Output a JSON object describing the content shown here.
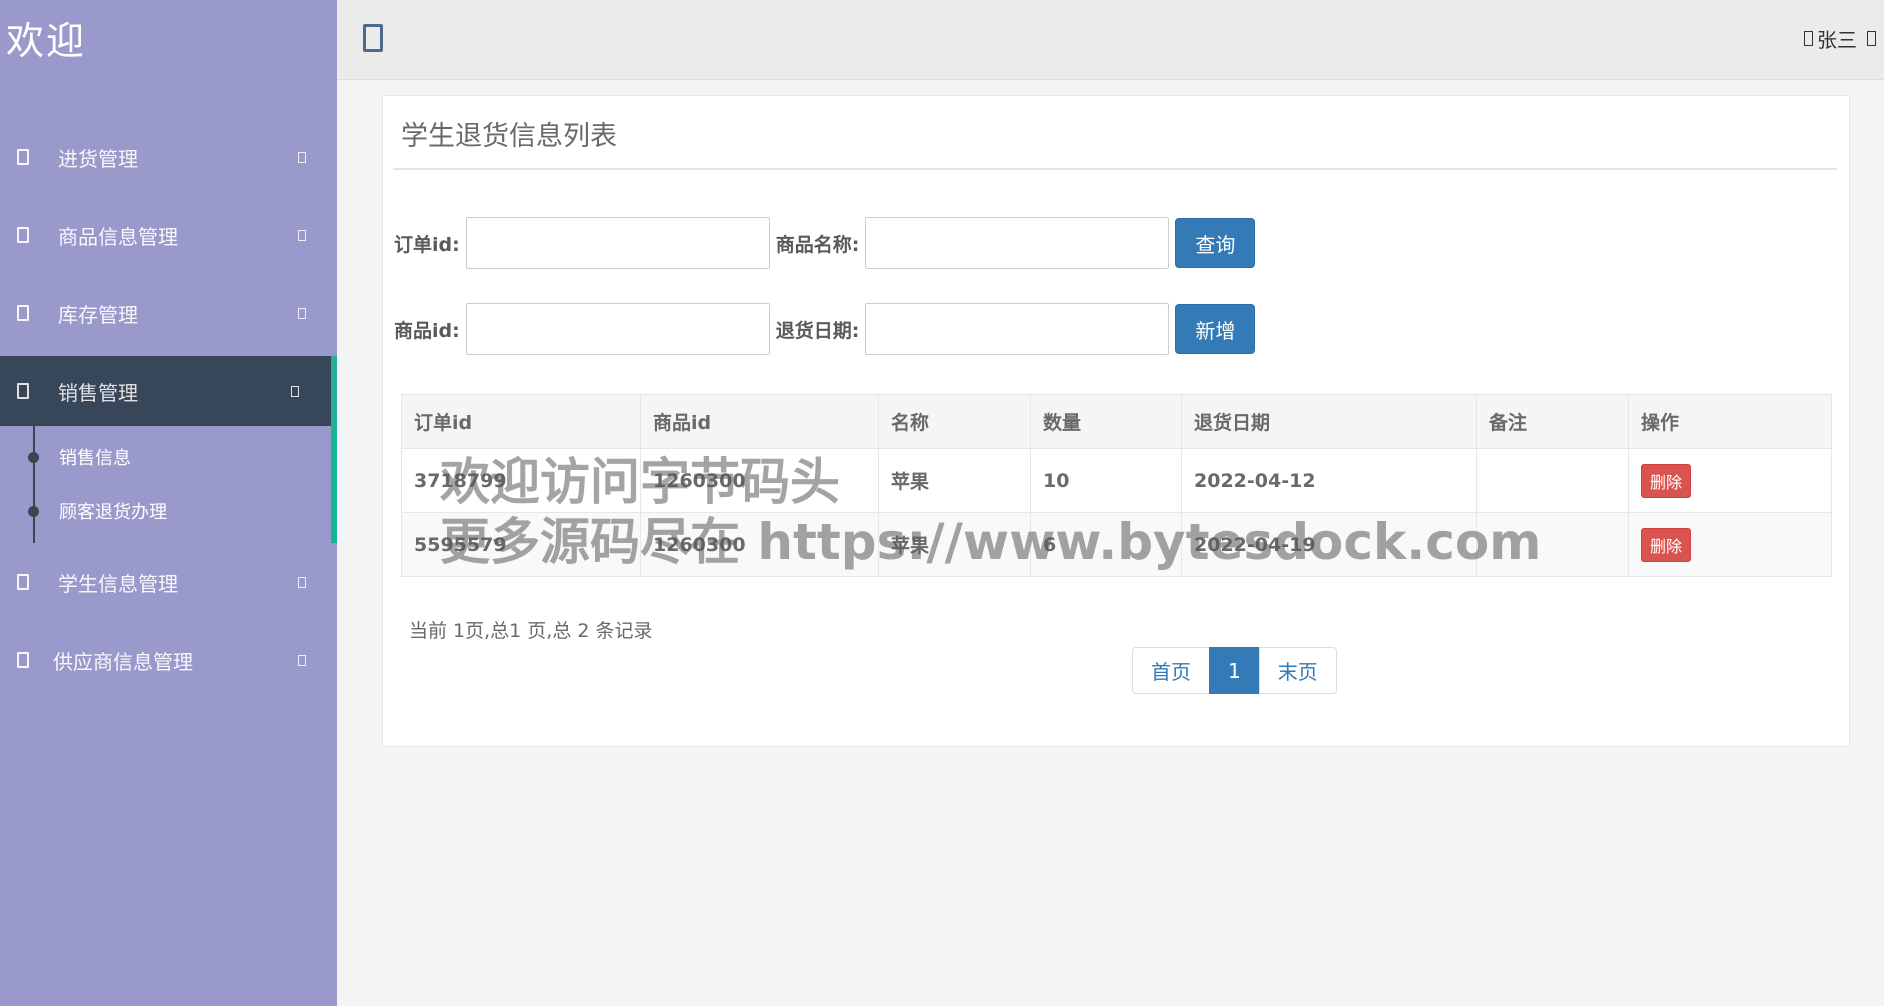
{
  "sidebar": {
    "brand": "欢迎",
    "items": [
      {
        "label": "进货管理"
      },
      {
        "label": "商品信息管理"
      },
      {
        "label": "库存管理"
      },
      {
        "label": "销售管理"
      },
      {
        "label": "学生信息管理"
      },
      {
        "label": "供应商信息管理"
      }
    ],
    "submenu": [
      {
        "label": "销售信息"
      },
      {
        "label": "顾客退货办理"
      }
    ]
  },
  "topbar": {
    "user": "张三"
  },
  "panel": {
    "title": "学生退货信息列表"
  },
  "search": {
    "order_id_label": "订单id:",
    "order_id_value": "",
    "product_name_label": "商品名称:",
    "product_name_value": "",
    "query_button": "查询",
    "product_id_label": "商品id:",
    "product_id_value": "",
    "return_date_label": "退货日期:",
    "return_date_value": "",
    "add_button": "新增"
  },
  "table": {
    "headers": [
      "订单id",
      "商品id",
      "名称",
      "数量",
      "退货日期",
      "备注",
      "操作"
    ],
    "rows": [
      {
        "order_id": "3718799",
        "product_id": "1260300",
        "name": "苹果",
        "qty": "10",
        "date": "2022-04-12",
        "note": "",
        "action": "删除"
      },
      {
        "order_id": "5595579",
        "product_id": "1260300",
        "name": "苹果",
        "qty": "6",
        "date": "2022-04-19",
        "note": "",
        "action": "删除"
      }
    ]
  },
  "pagination": {
    "info": "当前 1页,总1 页,总 2 条记录",
    "first": "首页",
    "current": "1",
    "last": "末页"
  },
  "watermark": {
    "line1": "欢迎访问字节码头",
    "line2": "更多源码尽在  https://www.bytesdock.com"
  }
}
